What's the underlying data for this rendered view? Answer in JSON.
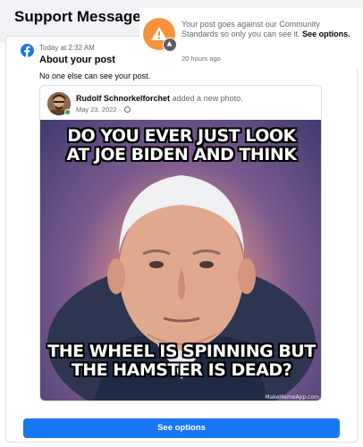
{
  "header": {
    "title": "Support Message"
  },
  "notification": {
    "text": "Your post goes against our Community Standards so only you can see it.",
    "action": "See options.",
    "time": "20 hours ago",
    "icon": "warning-triangle-icon",
    "badge_icon": "restricted-badge-icon",
    "accent_color": "#f7923a"
  },
  "message": {
    "logo_icon": "facebook-logo-icon",
    "time": "Today at 2:32 AM",
    "title": "About your post",
    "body": "No one else can see your post."
  },
  "post": {
    "author": "Rudolf Schnorkelforchet",
    "action": "added a new photo.",
    "date": "May 23, 2022 · ",
    "privacy_icon": "globe-icon",
    "meme": {
      "top_text_line1": "DO YOU EVER JUST LOOK",
      "top_text_line2": "AT JOE BIDEN AND THINK",
      "bottom_text_line1": "THE WHEEL IS SPINNING BUT",
      "bottom_text_line2": "THE HAMSTER IS DEAD?",
      "watermark": "MakeMemeApp.com"
    }
  },
  "footer": {
    "button_label": "See options",
    "button_color": "#1877f2"
  }
}
